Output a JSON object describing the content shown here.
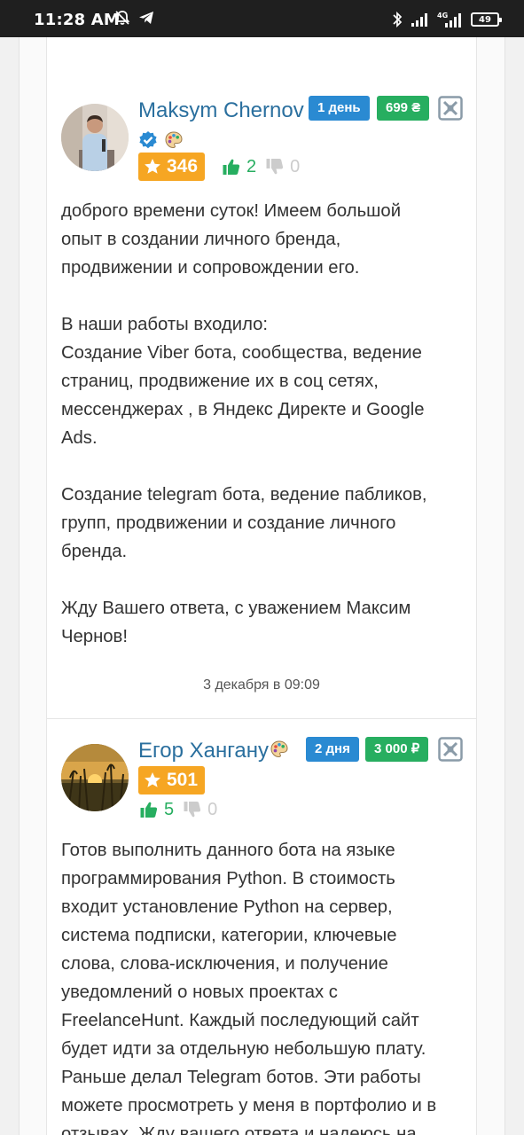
{
  "status_bar": {
    "time": "11:28 AM",
    "network": "4G",
    "battery": "49",
    "icons": [
      "mute-bell-icon",
      "telegram-icon",
      "bluetooth-icon",
      "signal-icon",
      "signal-4g-icon",
      "battery-icon"
    ]
  },
  "colors": {
    "name": "#2a6f9e",
    "badge_blue": "#2a8ad2",
    "badge_green": "#27ae60",
    "rating": "#f6a623",
    "like": "#27ae60",
    "dislike": "#cccccc"
  },
  "bids": [
    {
      "name": "Maksym Chernov",
      "icons": [
        "verified-icon",
        "palette-icon"
      ],
      "term": "1 день",
      "price": "699 ₴",
      "rating": "346",
      "likes": "2",
      "dislikes": "0",
      "paragraphs": [
        [
          "доброго времени суток! Имеем большой",
          "опыт в создании личного бренда,",
          "продвижении и сопровождении его."
        ],
        [
          "В наши работы входило:",
          "Создание Viber бота, сообщества, ведение",
          "страниц, продвижение их в соц сетях,",
          "мессенджерах , в Яндекс Директе и Google",
          "Ads."
        ],
        [
          "Создание telegram бота, ведение пабликов,",
          "групп, продвижении и создание личного",
          "бренда."
        ],
        [
          "Жду Вашего ответа, с уважением Максим",
          "Чернов!"
        ]
      ],
      "date": "3 декабря в 09:09"
    },
    {
      "name": "Егор Хангану",
      "icons": [
        "palette-icon"
      ],
      "term": "2 дня",
      "price": "3 000 ₽",
      "rating": "501",
      "likes": "5",
      "dislikes": "0",
      "paragraphs": [
        [
          "Готов выполнить данного бота на языке",
          "программирования Python. В стоимость",
          "входит установление Python на сервер,",
          "система подписки, категории, ключевые",
          "слова, слова-исключения, и получение",
          "уведомлений о новых проектах с",
          "FreelanceHunt. Каждый последующий сайт",
          "будет идти за отдельную небольшую плату.",
          "Раньше делал Telegram ботов. Эти работы",
          "можете просмотреть у меня в портфолио и в",
          "отзывах. Жду вашего ответа и надеюсь на"
        ]
      ]
    }
  ]
}
